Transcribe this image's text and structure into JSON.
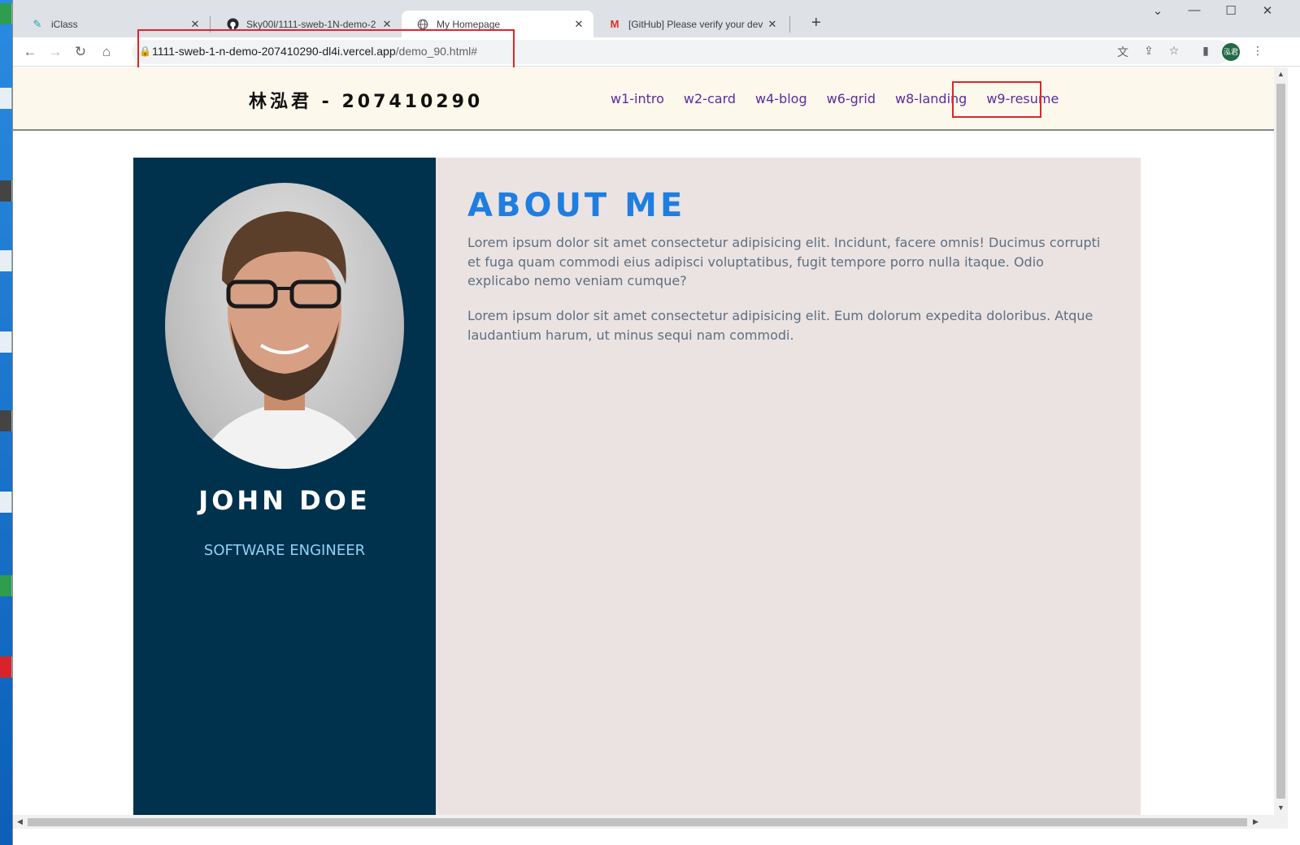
{
  "browser": {
    "tabs": [
      {
        "label": "iClass",
        "icon": "iclass-icon"
      },
      {
        "label": "Sky00l/1111-sweb-1N-demo-2",
        "icon": "github-icon"
      },
      {
        "label": "My Homepage",
        "icon": "globe-icon"
      },
      {
        "label": "[GitHub] Please verify your dev",
        "icon": "gmail-icon"
      }
    ],
    "url_host": "1111-sweb-1-n-demo-207410290-dl4i.vercel.app",
    "url_path": "/demo_90.html#",
    "profile_initials": "泓君"
  },
  "site": {
    "title": "林泓君 - 207410290",
    "nav": [
      "w1-intro",
      "w2-card",
      "w4-blog",
      "w6-grid",
      "w8-landing",
      "w9-resume"
    ]
  },
  "resume": {
    "name": "JOHN DOE",
    "job_title": "SOFTWARE ENGINEER",
    "about_title": "ABOUT ME",
    "paragraphs": [
      "Lorem ipsum dolor sit amet consectetur adipisicing elit. Incidunt, facere omnis! Ducimus corrupti et fuga quam commodi eius adipisci voluptatibus, fugit tempore porro nulla itaque. Odio explicabo nemo veniam cumque?",
      "Lorem ipsum dolor sit amet consectetur adipisicing elit. Eum dolorum expedita doloribus. Atque laudantium harum, ut minus sequi nam commodi."
    ]
  },
  "colors": {
    "sidebar": "#00314d",
    "about_title": "#1f7ee0",
    "job_title": "#8fd3f5",
    "highlight_box": "#e0242b"
  }
}
